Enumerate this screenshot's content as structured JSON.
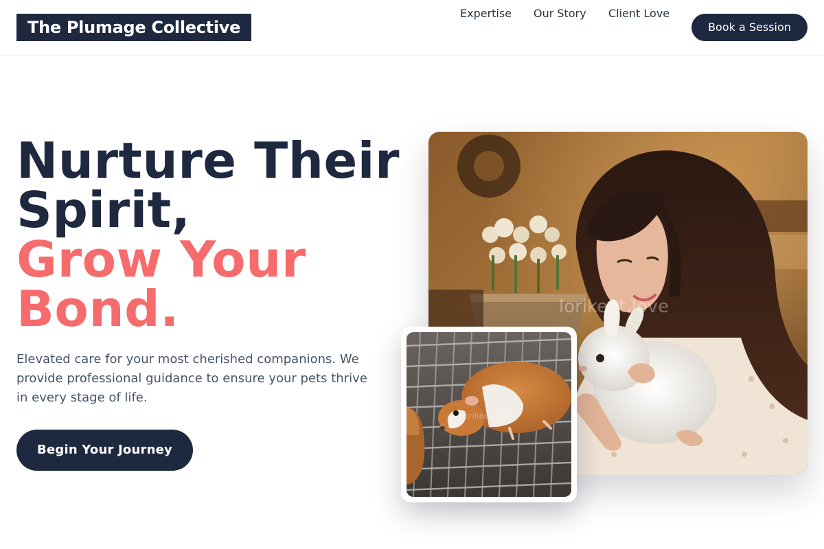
{
  "header": {
    "logo": "The Plumage Collective",
    "nav": {
      "expertise": "Expertise",
      "story": "Our Story",
      "love": "Client Love"
    },
    "cta": "Book a Session"
  },
  "hero": {
    "title_line1": "Nurture Their",
    "title_line2": "Spirit,",
    "title_line3": "Grow Your",
    "title_line4": "Bond.",
    "description": "Elevated care for your most cherished companions. We provide professional guidance to ensure your pets thrive in every stage of life.",
    "cta": "Begin Your Journey"
  },
  "images": {
    "main_watermark": "lorikeet.love",
    "small_watermark": "lorikeet.love"
  },
  "colors": {
    "brand_navy": "#1e2940",
    "accent_coral": "#f66b6b",
    "body_text": "#475569"
  }
}
